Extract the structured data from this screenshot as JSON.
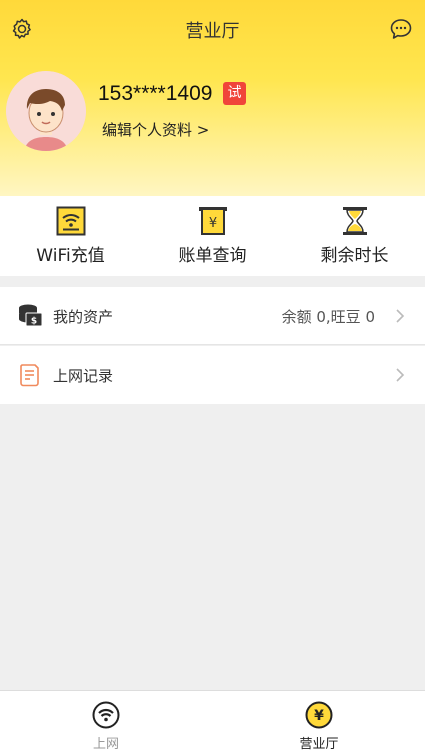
{
  "header": {
    "title": "营业厅",
    "settings_icon": "gear-icon",
    "message_icon": "chat-bubble-icon"
  },
  "profile": {
    "phone": "153****1409",
    "badge": "试",
    "edit_label": "编辑个人资料 >"
  },
  "quick_actions": [
    {
      "label": "WiFi充值",
      "icon": "wifi-card-icon"
    },
    {
      "label": "账单查询",
      "icon": "bill-yen-icon"
    },
    {
      "label": "剩余时长",
      "icon": "hourglass-icon"
    }
  ],
  "list": {
    "assets": {
      "label": "我的资产",
      "value": "余额 0,旺豆 0",
      "icon": "money-stack-icon"
    },
    "records": {
      "label": "上网记录",
      "icon": "document-icon"
    }
  },
  "tabbar": {
    "tabs": [
      {
        "label": "上网",
        "icon": "wifi-icon",
        "active": false
      },
      {
        "label": "营业厅",
        "icon": "yen-coin-icon",
        "active": true
      }
    ]
  },
  "colors": {
    "brand_yellow": "#ffd93a",
    "badge_red": "#f0453a",
    "accent_orange": "#f08a5d"
  }
}
